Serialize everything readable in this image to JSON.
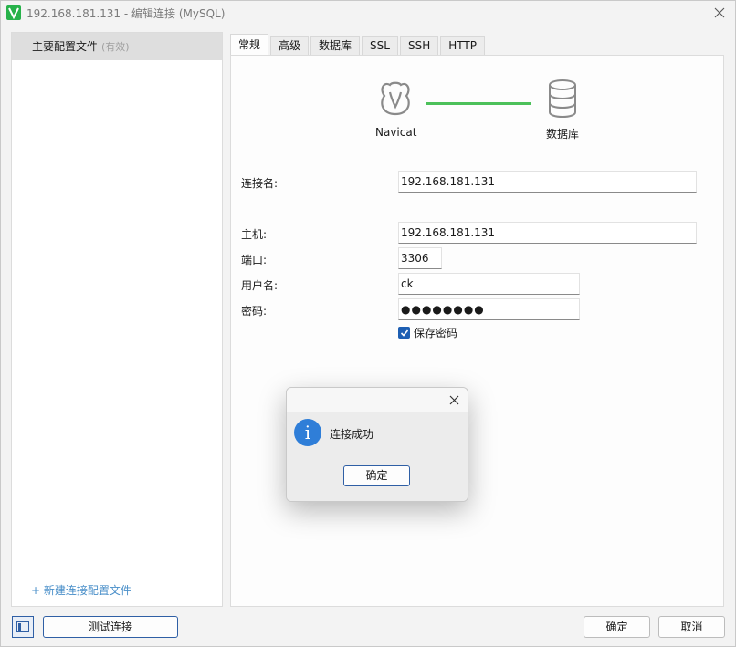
{
  "window": {
    "title": "192.168.181.131 - 编辑连接 (MySQL)",
    "app_icon": "navicat-logo-icon",
    "accent_color": "#2f5fa5"
  },
  "sidebar": {
    "profile": {
      "label": "主要配置文件",
      "status": "(有效)"
    },
    "new_profile": "+ 新建连接配置文件"
  },
  "tabs": [
    {
      "label": "常规",
      "active": true
    },
    {
      "label": "高级"
    },
    {
      "label": "数据库"
    },
    {
      "label": "SSL"
    },
    {
      "label": "SSH"
    },
    {
      "label": "HTTP"
    }
  ],
  "diagram": {
    "left_label": "Navicat",
    "right_label": "数据库",
    "line_color": "#4cc15a"
  },
  "form": {
    "connection_name": {
      "label": "连接名:",
      "value": "192.168.181.131"
    },
    "host": {
      "label": "主机:",
      "value": "192.168.181.131"
    },
    "port": {
      "label": "端口:",
      "value": "3306"
    },
    "username": {
      "label": "用户名:",
      "value": "ck"
    },
    "password": {
      "label": "密码:",
      "value": "●●●●●●●●"
    },
    "save_password": {
      "label": "保存密码",
      "checked": true
    }
  },
  "footer": {
    "test_connection": "测试连接",
    "ok": "确定",
    "cancel": "取消"
  },
  "dialog": {
    "message": "连接成功",
    "ok": "确定",
    "icon": "info-icon"
  }
}
